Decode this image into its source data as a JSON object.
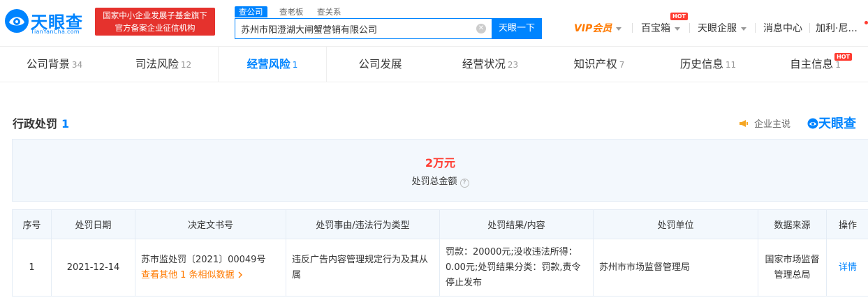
{
  "brand": {
    "name": "天眼查",
    "domain": "TianYanCha.com",
    "banner_line1": "国家中小企业发展子基金旗下",
    "banner_line2": "官方备案企业征信机构"
  },
  "search": {
    "tabs": [
      "查公司",
      "查老板",
      "查关系"
    ],
    "value": "苏州市阳澄湖大闸蟹营销有限公司",
    "button": "天眼一下"
  },
  "topnav": {
    "vip": "VIP会员",
    "toolbox": "百宝箱",
    "enterprise": "天眼企服",
    "messages": "消息中心",
    "user": "加利·尼...",
    "hot_badge": "HOT"
  },
  "tabs": [
    {
      "label": "公司背景",
      "count": "34"
    },
    {
      "label": "司法风险",
      "count": "12"
    },
    {
      "label": "经营风险",
      "count": "1"
    },
    {
      "label": "公司发展",
      "count": ""
    },
    {
      "label": "经营状况",
      "count": "23"
    },
    {
      "label": "知识产权",
      "count": "7"
    },
    {
      "label": "历史信息",
      "count": "11"
    },
    {
      "label": "自主信息",
      "count": "1"
    }
  ],
  "section": {
    "title": "行政处罚",
    "count": "1",
    "promo": "企业主说",
    "brand": "天眼查"
  },
  "summary": {
    "value": "2万元",
    "label": "处罚总金额"
  },
  "table": {
    "headers": [
      "序号",
      "处罚日期",
      "决定文书号",
      "处罚事由/违法行为类型",
      "处罚结果/内容",
      "处罚单位",
      "数据来源",
      "操作"
    ],
    "rows": [
      {
        "index": "1",
        "date": "2021-12-14",
        "doc_no": "苏市监处罚〔2021〕00049号",
        "more_link": "查看其他 1 条相似数据",
        "reason": "违反广告内容管理规定行为及其从属",
        "result": "罚款：20000元;没收违法所得：0.00元;处罚结果分类：罚款,责令停止发布",
        "authority": "苏州市市场监督管理局",
        "source": "国家市场监督管理总局",
        "action": "详情"
      }
    ]
  },
  "colors": {
    "brand_blue": "#0084ff",
    "red": "#ff3b30",
    "orange": "#ff7a00",
    "banner_red": "#e5322d"
  }
}
